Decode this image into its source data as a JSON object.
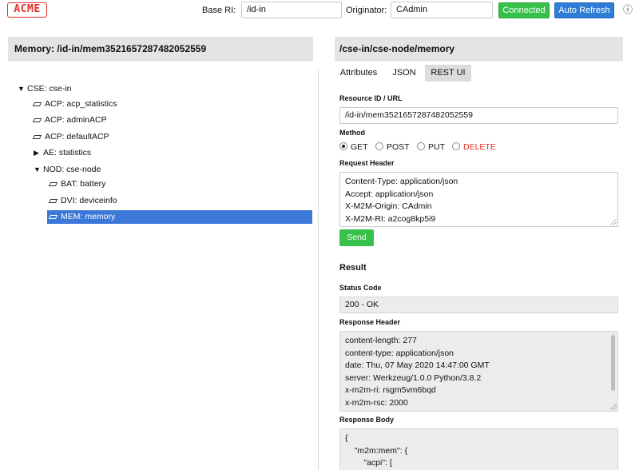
{
  "topbar": {
    "logo": "ACME",
    "base_ri_label": "Base RI:",
    "base_ri_value": "/id-in",
    "originator_label": "Originator:",
    "originator_value": "CAdmin",
    "connected_label": "Connected",
    "auto_refresh_label": "Auto Refresh",
    "info_icon": "info-icon"
  },
  "left": {
    "title": "Memory: /id-in/mem3521657287482052559",
    "tree": [
      {
        "label": "CSE: cse-in",
        "icon": "triangle-down-icon",
        "expanded": true
      },
      {
        "label": "ACP: acp_statistics",
        "icon": "leaf-icon"
      },
      {
        "label": "ACP: adminACP",
        "icon": "leaf-icon"
      },
      {
        "label": "ACP: defaultACP",
        "icon": "leaf-icon"
      },
      {
        "label": "AE: statistics",
        "icon": "triangle-right-icon",
        "expanded": false
      },
      {
        "label": "NOD: cse-node",
        "icon": "triangle-down-icon",
        "expanded": true
      },
      {
        "label": "BAT: battery",
        "icon": "leaf-icon"
      },
      {
        "label": "DVI: deviceinfo",
        "icon": "leaf-icon"
      },
      {
        "label": "MEM: memory",
        "icon": "leaf-icon",
        "selected": true
      }
    ]
  },
  "right": {
    "title": "/cse-in/cse-node/memory",
    "tabs": [
      "Attributes",
      "JSON",
      "REST UI"
    ],
    "active_tab": "REST UI",
    "resource_label": "Resource ID / URL",
    "resource_value": "/id-in/mem3521657287482052559",
    "method_label": "Method",
    "methods": [
      "GET",
      "POST",
      "PUT",
      "DELETE"
    ],
    "selected_method": "GET",
    "request_header_label": "Request Header",
    "request_header_lines": [
      "Content-Type: application/json",
      "Accept: application/json",
      "X-M2M-Origin: CAdmin",
      "X-M2M-RI: a2cog8kp5i9"
    ],
    "send_label": "Send",
    "result_title": "Result",
    "status_code_label": "Status Code",
    "status_code_value": "200 - OK",
    "response_header_label": "Response Header",
    "response_header_lines": [
      "content-length: 277",
      "content-type: application/json",
      "date: Thu, 07 May 2020 14:47:00 GMT",
      "server: Werkzeug/1.0.0 Python/3.8.2",
      "x-m2m-ri: rsgm5vm6bqd",
      "x-m2m-rsc: 2000"
    ],
    "response_body_label": "Response Body",
    "response_body": "{\n    \"m2m:mem\": {\n        \"acpi\": ["
  },
  "colors": {
    "connected": "#37c14a",
    "auto_refresh": "#2f7cd6",
    "selection": "#3b78d7",
    "delete": "#e0302c",
    "logo": "#e0302c"
  }
}
